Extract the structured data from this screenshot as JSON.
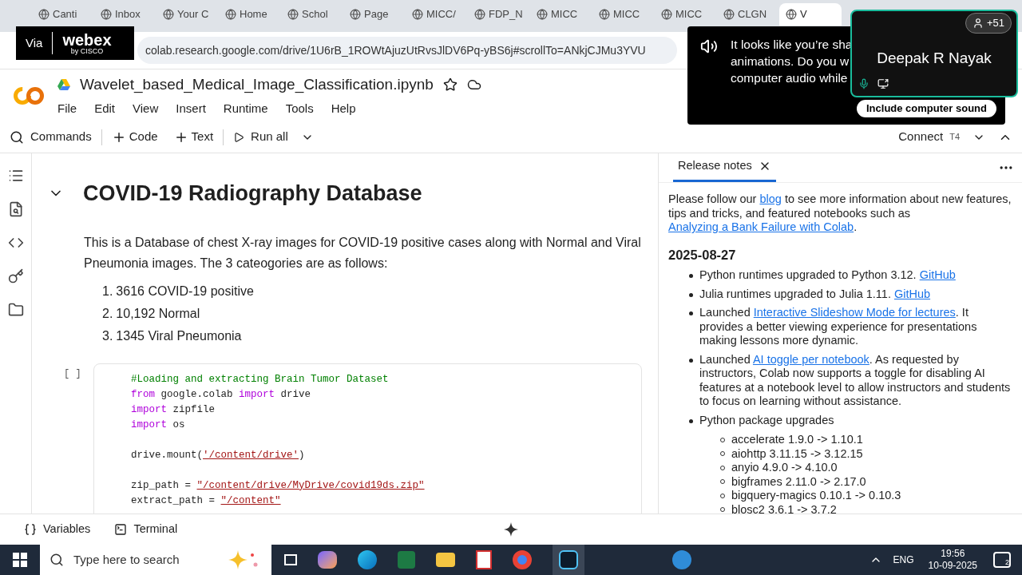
{
  "browser": {
    "tabs": [
      {
        "title": "Canti",
        "selected": false
      },
      {
        "title": "Inbox",
        "selected": false
      },
      {
        "title": "Your C",
        "selected": false
      },
      {
        "title": "Home",
        "selected": false
      },
      {
        "title": "Schol",
        "selected": false
      },
      {
        "title": "Page",
        "selected": false
      },
      {
        "title": "MICC/",
        "selected": false
      },
      {
        "title": "FDP_N",
        "selected": false
      },
      {
        "title": "MICC",
        "selected": false
      },
      {
        "title": "MICC",
        "selected": false
      },
      {
        "title": "MICC",
        "selected": false
      },
      {
        "title": "CLGN",
        "selected": false
      },
      {
        "title": "V",
        "selected": true
      }
    ],
    "url": "colab.research.google.com/drive/1U6rB_1ROWtAjuzUtRvsJlDV6Pq-yBS6j#scrollTo=ANkjCJMu3YVU"
  },
  "webex": {
    "via": "Via",
    "brand": "webex",
    "maker": "by CISCO"
  },
  "notebook": {
    "name": "Wavelet_based_Medical_Image_Classification.ipynb",
    "menu": [
      "File",
      "Edit",
      "View",
      "Insert",
      "Runtime",
      "Tools",
      "Help"
    ]
  },
  "toolbar": {
    "commands": "Commands",
    "add_code": "Code",
    "add_text": "Text",
    "run_all": "Run all",
    "connect": "Connect",
    "runtime_type": "T4"
  },
  "section": {
    "title": "COVID-19 Radiography Database",
    "expanded": true,
    "intro": "This is a Database of chest X-ray images for COVID-19 positive cases along with Normal and Viral Pneumonia images. The 3 cateogories are as follows:",
    "list": [
      {
        "num": "1.",
        "text": "3616 COVID-19 positive"
      },
      {
        "num": "2.",
        "text": "10,192 Normal"
      },
      {
        "num": "3.",
        "text": "1345 Viral Pneumonia"
      }
    ]
  },
  "code_cell": {
    "prompt": "[ ]",
    "lines": [
      {
        "blank_before": false,
        "tokens": [
          {
            "kind": "comment",
            "text": "#Loading and extracting Brain Tumor Dataset"
          }
        ]
      },
      {
        "blank_before": false,
        "tokens": [
          {
            "kind": "keyword",
            "text": "from"
          },
          {
            "kind": "plain",
            "text": " google.colab "
          },
          {
            "kind": "keyword",
            "text": "import"
          },
          {
            "kind": "plain",
            "text": " drive"
          }
        ]
      },
      {
        "blank_before": false,
        "tokens": [
          {
            "kind": "keyword",
            "text": "import"
          },
          {
            "kind": "plain",
            "text": " zipfile"
          }
        ]
      },
      {
        "blank_before": false,
        "tokens": [
          {
            "kind": "keyword",
            "text": "import"
          },
          {
            "kind": "plain",
            "text": " os"
          }
        ]
      },
      {
        "blank_before": true,
        "tokens": [
          {
            "kind": "plain",
            "text": "drive.mount("
          },
          {
            "kind": "string",
            "text": "'/content/drive'"
          },
          {
            "kind": "plain",
            "text": ")"
          }
        ]
      },
      {
        "blank_before": true,
        "tokens": [
          {
            "kind": "plain",
            "text": "zip_path = "
          },
          {
            "kind": "string",
            "text": "\"/content/drive/MyDrive/covid19ds.zip\""
          }
        ]
      },
      {
        "blank_before": false,
        "tokens": [
          {
            "kind": "plain",
            "text": "extract_path = "
          },
          {
            "kind": "string",
            "text": "\"/content\""
          }
        ]
      }
    ]
  },
  "release_notes": {
    "tab": "Release notes",
    "intro": [
      {
        "kind": "text",
        "text": "Please follow our "
      },
      {
        "kind": "link",
        "text": "blog"
      },
      {
        "kind": "text",
        "text": " to see more information about new features, tips and tricks, and featured notebooks such as "
      },
      {
        "kind": "link",
        "text": "Analyzing a Bank Failure with Colab"
      },
      {
        "kind": "text",
        "text": "."
      }
    ],
    "date": "2025-08-27",
    "items": [
      {
        "parts": [
          {
            "kind": "text",
            "text": "Python runtimes upgraded to Python 3.12. "
          },
          {
            "kind": "link",
            "text": "GitHub"
          }
        ]
      },
      {
        "parts": [
          {
            "kind": "text",
            "text": "Julia runtimes upgraded to Julia 1.11. "
          },
          {
            "kind": "link",
            "text": "GitHub"
          }
        ]
      },
      {
        "parts": [
          {
            "kind": "text",
            "text": "Launched "
          },
          {
            "kind": "link",
            "text": "Interactive Slideshow Mode for lectures"
          },
          {
            "kind": "text",
            "text": ". It provides a better viewing experience for presentations making lessons more dynamic."
          }
        ]
      },
      {
        "parts": [
          {
            "kind": "text",
            "text": "Launched "
          },
          {
            "kind": "link",
            "text": "AI toggle per notebook"
          },
          {
            "kind": "text",
            "text": ". As requested by instructors, Colab now supports a toggle for disabling AI features at a notebook level to allow instructors and students to focus on learning without assistance."
          }
        ]
      },
      {
        "parts": [
          {
            "kind": "text",
            "text": "Python package upgrades"
          }
        ],
        "children": [
          "accelerate 1.9.0 -> 1.10.1",
          "aiohttp 3.11.15 -> 3.12.15",
          "anyio 4.9.0 -> 4.10.0",
          "bigframes 2.11.0 -> 2.17.0",
          "bigquery-magics 0.10.1 -> 0.10.3",
          "blosc2 3.6.1 -> 3.7.2"
        ]
      }
    ]
  },
  "bottom_bar": {
    "variables": "Variables",
    "terminal": "Terminal"
  },
  "audio_prompt": {
    "lines": [
      "It looks like you’re sha",
      "animations. Do you w",
      "computer audio while"
    ],
    "button": "Include computer sound"
  },
  "participant": {
    "name": "Deepak R Nayak",
    "count": "+51"
  },
  "taskbar": {
    "search_placeholder": "Type here to search",
    "language": "ENG",
    "time": "19:56",
    "date": "10-09-2025",
    "notifications": "2"
  }
}
